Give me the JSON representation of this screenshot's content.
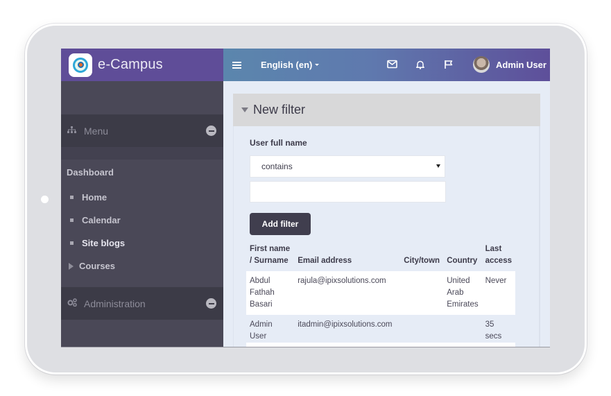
{
  "brand": {
    "name": "e-Campus",
    "logo_icon": "campus-crest-logo"
  },
  "topnav": {
    "menu_icon": "hamburger-icon",
    "language": "English (en)",
    "icons": [
      "mail-icon",
      "bell-icon",
      "flag-icon"
    ],
    "user_name": "Admin User"
  },
  "sidebar": {
    "menu_section": {
      "label": "Menu",
      "icon": "sitemap-icon"
    },
    "nav_heading": "Dashboard",
    "items": [
      {
        "label": "Home",
        "marker": "bullet"
      },
      {
        "label": "Calendar",
        "marker": "bullet"
      },
      {
        "label": "Site blogs",
        "marker": "bullet"
      },
      {
        "label": "Courses",
        "marker": "caret"
      }
    ],
    "admin_section": {
      "label": "Administration",
      "icon": "cogs-icon"
    }
  },
  "filter": {
    "title": "New filter",
    "field_label": "User full name",
    "operator": "contains",
    "value": "",
    "add_button": "Add filter"
  },
  "table": {
    "headers": [
      "First name / Surname",
      "Email address",
      "City/town",
      "Country",
      "Last access"
    ],
    "rows": [
      {
        "name": "Abdul Fathah Basari",
        "email": "rajula@ipixsolutions.com",
        "city": "",
        "country": "United Arab Emirates",
        "last_access": "Never"
      },
      {
        "name": "Admin User",
        "email": "itadmin@ipixsolutions.com",
        "city": "",
        "country": "",
        "last_access": "35 secs"
      }
    ]
  },
  "colors": {
    "brand_purple": "#5f4d98",
    "sidebar_bg": "#4a4857",
    "section_bg": "#3c3b47",
    "button_dark": "#403e4e",
    "content_bg": "#e6ecf6"
  }
}
